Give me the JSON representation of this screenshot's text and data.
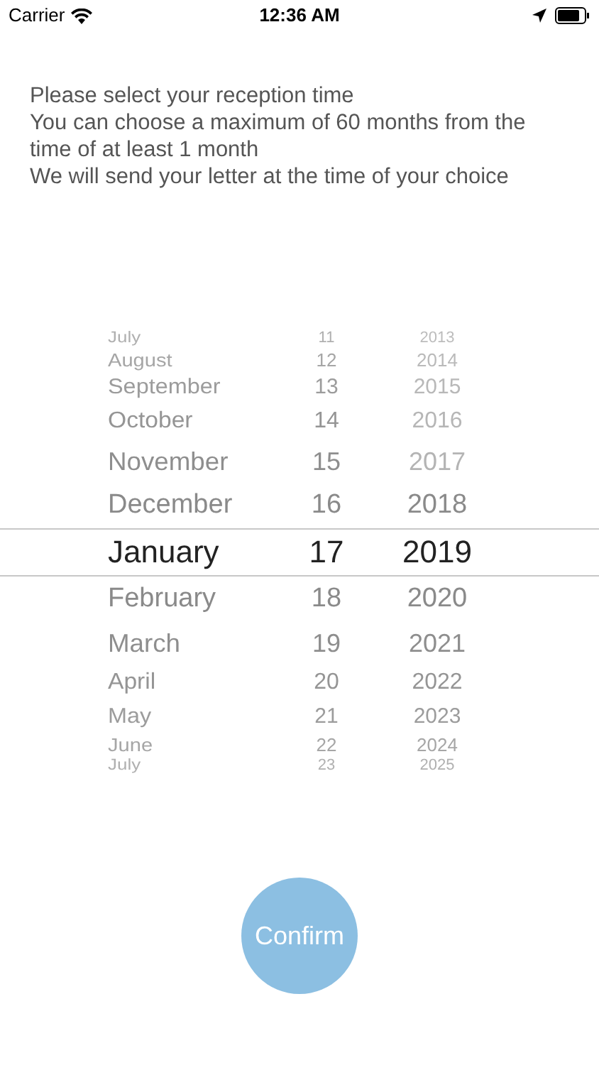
{
  "status_bar": {
    "carrier": "Carrier",
    "time": "12:36 AM"
  },
  "instructions": [
    "Please select your reception time",
    "You can choose a maximum of 60 months from the time of at least 1 month",
    "We will send your letter at the time of your choice"
  ],
  "picker": {
    "rows": [
      {
        "month": "July",
        "day": "11",
        "year": "2013",
        "year_disabled": true,
        "selected": false
      },
      {
        "month": "August",
        "day": "12",
        "year": "2014",
        "year_disabled": true,
        "selected": false
      },
      {
        "month": "September",
        "day": "13",
        "year": "2015",
        "year_disabled": true,
        "selected": false
      },
      {
        "month": "October",
        "day": "14",
        "year": "2016",
        "year_disabled": true,
        "selected": false
      },
      {
        "month": "November",
        "day": "15",
        "year": "2017",
        "year_disabled": true,
        "selected": false
      },
      {
        "month": "December",
        "day": "16",
        "year": "2018",
        "year_disabled": false,
        "selected": false
      },
      {
        "month": "January",
        "day": "17",
        "year": "2019",
        "year_disabled": false,
        "selected": true
      },
      {
        "month": "February",
        "day": "18",
        "year": "2020",
        "year_disabled": false,
        "selected": false
      },
      {
        "month": "March",
        "day": "19",
        "year": "2021",
        "year_disabled": false,
        "selected": false
      },
      {
        "month": "April",
        "day": "20",
        "year": "2022",
        "year_disabled": false,
        "selected": false
      },
      {
        "month": "May",
        "day": "21",
        "year": "2023",
        "year_disabled": false,
        "selected": false
      },
      {
        "month": "June",
        "day": "22",
        "year": "2024",
        "year_disabled": false,
        "selected": false
      },
      {
        "month": "July",
        "day": "23",
        "year": "2025",
        "year_disabled": false,
        "selected": false
      }
    ]
  },
  "confirm_button": "Confirm"
}
